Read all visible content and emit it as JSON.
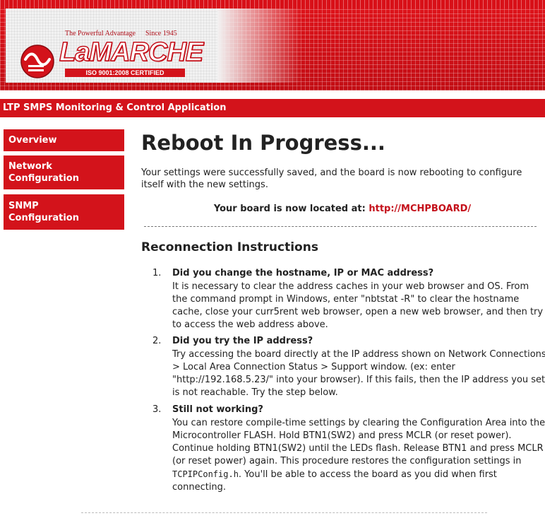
{
  "header": {
    "tagline": "The Powerful Advantage",
    "since": "Since 1945",
    "brand": "LaMARCHE",
    "certification": "ISO 9001:2008 CERTIFIED",
    "brand_color": "#d3131b"
  },
  "app_title": "LTP SMPS Monitoring & Control Application",
  "sidebar": {
    "items": [
      {
        "label": "Overview"
      },
      {
        "label": "Network Configuration"
      },
      {
        "label": "SNMP Configuration"
      }
    ]
  },
  "main": {
    "title": "Reboot In Progress...",
    "intro": "Your settings were successfully saved, and the board is now rebooting to configure itself with the new settings.",
    "location_prefix": "Your board is now located at:",
    "location_url": "http://MCHPBOARD/",
    "instructions_title": "Reconnection Instructions",
    "steps": [
      {
        "number": "1.",
        "title": "Did you change the hostname, IP or MAC address?",
        "body": "It is necessary to clear the address caches in your web browser and OS. From the command prompt in Windows, enter \"nbtstat -R\" to clear the hostname cache, close your curr5rent web browser, open a new web browser, and then try to access the web address above."
      },
      {
        "number": "2.",
        "title": "Did you try the IP address?",
        "body": "Try accessing the board directly at the IP address shown on Network Connections > Local Area Connection Status > Support window. (ex: enter \"http://192.168.5.23/\" into your browser). If this fails, then the IP address you set is not reachable. Try the step below."
      },
      {
        "number": "3.",
        "title": "Still not working?",
        "body_before": "You can restore compile-time settings by clearing the Configuration Area into the Microcontroller FLASH. Hold BTN1(SW2) and press MCLR (or reset power). Continue holding BTN1(SW2) until the LEDs flash. Release BTN1 and press MCLR (or reset power) again. This procedure restores the configuration settings in ",
        "code": "TCPIPConfig.h",
        "body_after": ". You'll be able to access the board as you did when first connecting."
      }
    ]
  }
}
